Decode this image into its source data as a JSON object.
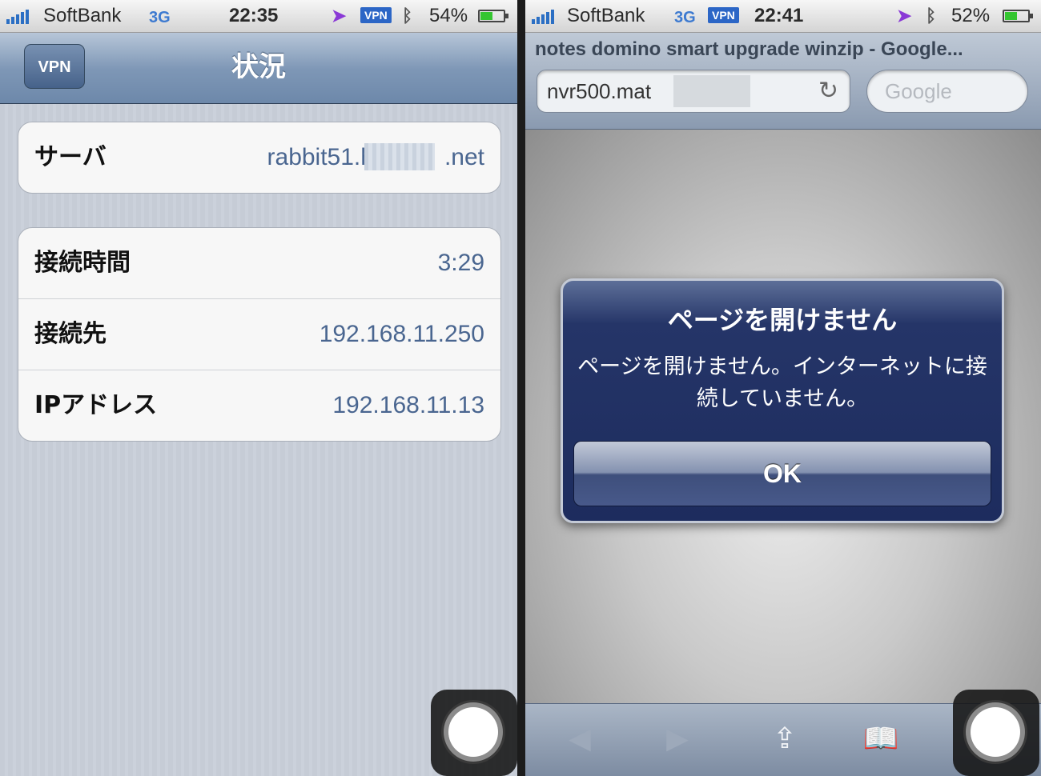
{
  "left_phone": {
    "status_bar": {
      "carrier": "SoftBank",
      "network": "3G",
      "time": "22:35",
      "vpn_badge": "VPN",
      "battery": "54%",
      "battery_level": 0.54
    },
    "nav": {
      "back_label": "VPN",
      "title": "状況"
    },
    "server_group": [
      {
        "label": "サーバ",
        "value_prefix": "rabbit51.h",
        "value_suffix": ".net"
      }
    ],
    "info_group": [
      {
        "label": "接続時間",
        "value": "3:29"
      },
      {
        "label": "接続先",
        "value": "192.168.11.250"
      },
      {
        "label": "IPアドレス",
        "value": "192.168.11.13"
      }
    ]
  },
  "right_phone": {
    "status_bar": {
      "carrier": "SoftBank",
      "network": "3G",
      "vpn_badge": "VPN",
      "time": "22:41",
      "battery": "52%",
      "battery_level": 0.52
    },
    "page_title": "notes domino smart upgrade winzip - Google...",
    "url": "nvr500.mat",
    "search_placeholder": "Google",
    "alert": {
      "title": "ページを開けません",
      "message": "ページを開けません。インターネットに接続していません。",
      "button": "OK"
    }
  },
  "icons": {
    "signal": "signal-bars-icon",
    "location": "location-arrow-icon",
    "bluetooth": "bluetooth-icon",
    "battery": "battery-icon",
    "reload": "reload-icon",
    "back": "back-arrow-icon",
    "forward": "forward-arrow-icon",
    "share": "share-icon",
    "bookmarks": "bookmarks-icon",
    "assistive_touch": "assistive-touch-icon"
  },
  "colors": {
    "nav_blue": "#6d88aa",
    "value_blue": "#4a6690",
    "alert_blue": "#1d2c5e",
    "vpn_badge": "#2c66c6",
    "location_purple": "#8a39d6",
    "battery_green": "#34c530"
  }
}
